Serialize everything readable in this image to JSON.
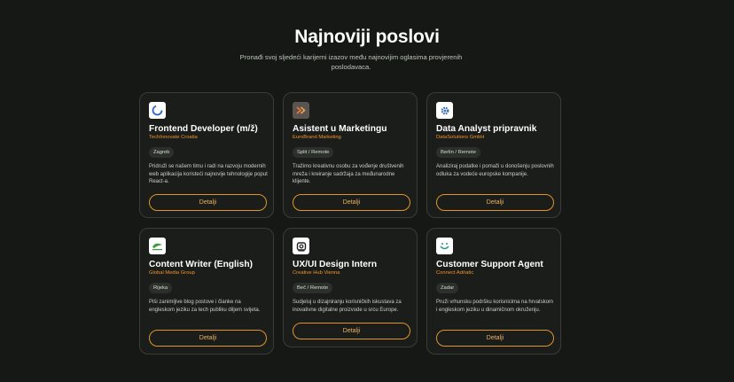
{
  "header": {
    "title": "Najnoviji poslovi",
    "subtitle": "Pronađi svoj sljedeći karijerni izazov među najnovijim oglasima provjerenih poslodavaca."
  },
  "colors": {
    "accent": "#f0932a",
    "background": "#161815",
    "card": "#1b1d1a"
  },
  "jobs": [
    {
      "title": "Frontend Developer (m/ž)",
      "company": "TechInnovate Croatia",
      "location": "Zagreb",
      "description": "Pridruži se našem timu i radi na razvoju modernih web aplikacija koristeći najnovije tehnologije poput React-a.",
      "button": "Detalji",
      "logo_icon": "blue-ring-logo-icon"
    },
    {
      "title": "Asistent u Marketingu",
      "company": "EuroBrand Marketing",
      "location": "Split / Remote",
      "description": "Tražimo kreativnu osobu za vođenje društvenih mreža i kreiranje sadržaja za međunarodne klijente.",
      "button": "Detalji",
      "logo_icon": "orange-arrows-logo-icon"
    },
    {
      "title": "Data Analyst pripravnik",
      "company": "DataSolutions GmbH",
      "location": "Berlin / Remote",
      "description": "Analiziraj podatke i pomaži u donošenju poslovnih odluka za vodeće europske kompanije.",
      "button": "Detalji",
      "logo_icon": "gear-logo-icon"
    },
    {
      "title": "Content Writer (English)",
      "company": "Global Media Group",
      "location": "Rijeka",
      "description": "Piši zanimljive blog postove i članke na engleskom jeziku za tech publiku diljem svijeta.",
      "button": "Detalji",
      "logo_icon": "green-leaf-logo-icon"
    },
    {
      "title": "UX/UI Design Intern",
      "company": "Creative Hub Vienna",
      "location": "Beč / Remote",
      "description": "Sudjeluj u dizajniranju korisničkih iskustava za inovativne digitalne proizvode u srcu Europe.",
      "button": "Detalji",
      "logo_icon": "camera-logo-icon"
    },
    {
      "title": "Customer Support Agent",
      "company": "Connect Adriatic",
      "location": "Zadar",
      "description": "Pruži vrhunsku podršku korisnicima na hrvatskom i engleskom jeziku u dinamičnom okruženju.",
      "button": "Detalji",
      "logo_icon": "smile-logo-icon"
    }
  ]
}
